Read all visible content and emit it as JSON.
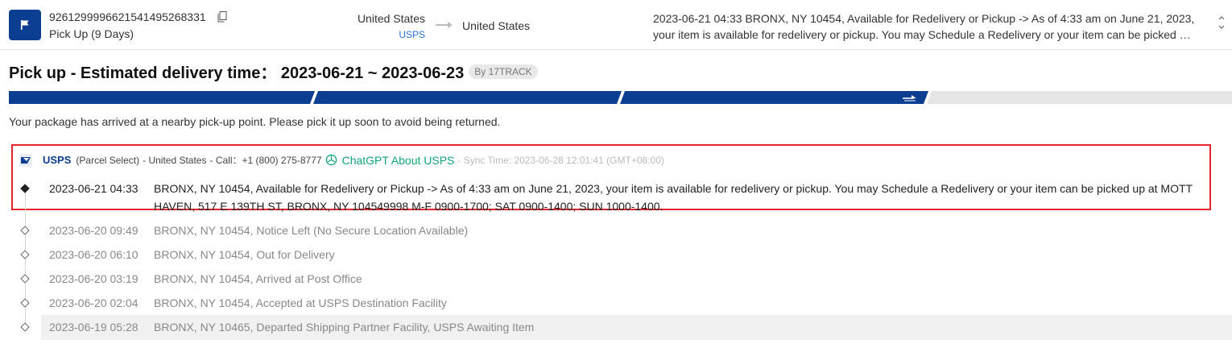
{
  "header": {
    "tracking_number": "9261299996621541495268331",
    "status": "Pick Up (9 Days)",
    "origin_country": "United States",
    "origin_carrier": "USPS",
    "destination_country": "United States",
    "latest_event": "2023-06-21 04:33  BRONX, NY 10454, Available for Redelivery or Pickup -> As of 4:33 am on June 21, 2023, your item is available for redelivery or pickup. You may Schedule a Redelivery or your item can be picked up at MOTT HAVEN, 517 E 139TH ST, BRONX, NY 104549998 M-F 0900-1700; SAT 0900-1400; SUN 1000-1400."
  },
  "summary": {
    "title": "Pick up - Estimated delivery time： 2023-06-21 ~ 2023-06-23",
    "badge": "By 17TRACK",
    "message": "Your package has arrived at a nearby pick-up point. Please pick it up soon to avoid being returned."
  },
  "progress": {
    "segments_total": 4,
    "segments_completed": 3,
    "active_color": "#0b3d91",
    "inactive_color": "#e5e5e5"
  },
  "carrier": {
    "name": "USPS",
    "service": "(Parcel Select)",
    "country": "- United States",
    "call": "- Call：+1 (800) 275-8777",
    "chatgpt_link": "ChatGPT About USPS",
    "sync_time": "- Sync Time: 2023-06-28 12:01:41 (GMT+08:00)"
  },
  "events": [
    {
      "time": "2023-06-21 04:33",
      "description": "BRONX, NY 10454, Available for Redelivery or Pickup -> As of 4:33 am on June 21, 2023, your item is available for redelivery or pickup. You may Schedule a Redelivery or your item can be picked up at MOTT HAVEN, 517 E 139TH ST, BRONX, NY 104549998 M-F 0900-1700; SAT 0900-1400; SUN 1000-1400."
    },
    {
      "time": "2023-06-20 09:49",
      "description": "BRONX, NY 10454, Notice Left (No Secure Location Available)"
    },
    {
      "time": "2023-06-20 06:10",
      "description": "BRONX, NY 10454, Out for Delivery"
    },
    {
      "time": "2023-06-20 03:19",
      "description": "BRONX, NY 10454, Arrived at Post Office"
    },
    {
      "time": "2023-06-20 02:04",
      "description": "BRONX, NY 10454, Accepted at USPS Destination Facility"
    },
    {
      "time": "2023-06-19 05:28",
      "description": "BRONX, NY 10465, Departed Shipping Partner Facility, USPS Awaiting Item"
    }
  ],
  "colors": {
    "brand_blue": "#0b3d91",
    "link_blue": "#2a6fdb",
    "chatgpt_green": "#10a37f",
    "highlight_red": "#e3262e"
  }
}
